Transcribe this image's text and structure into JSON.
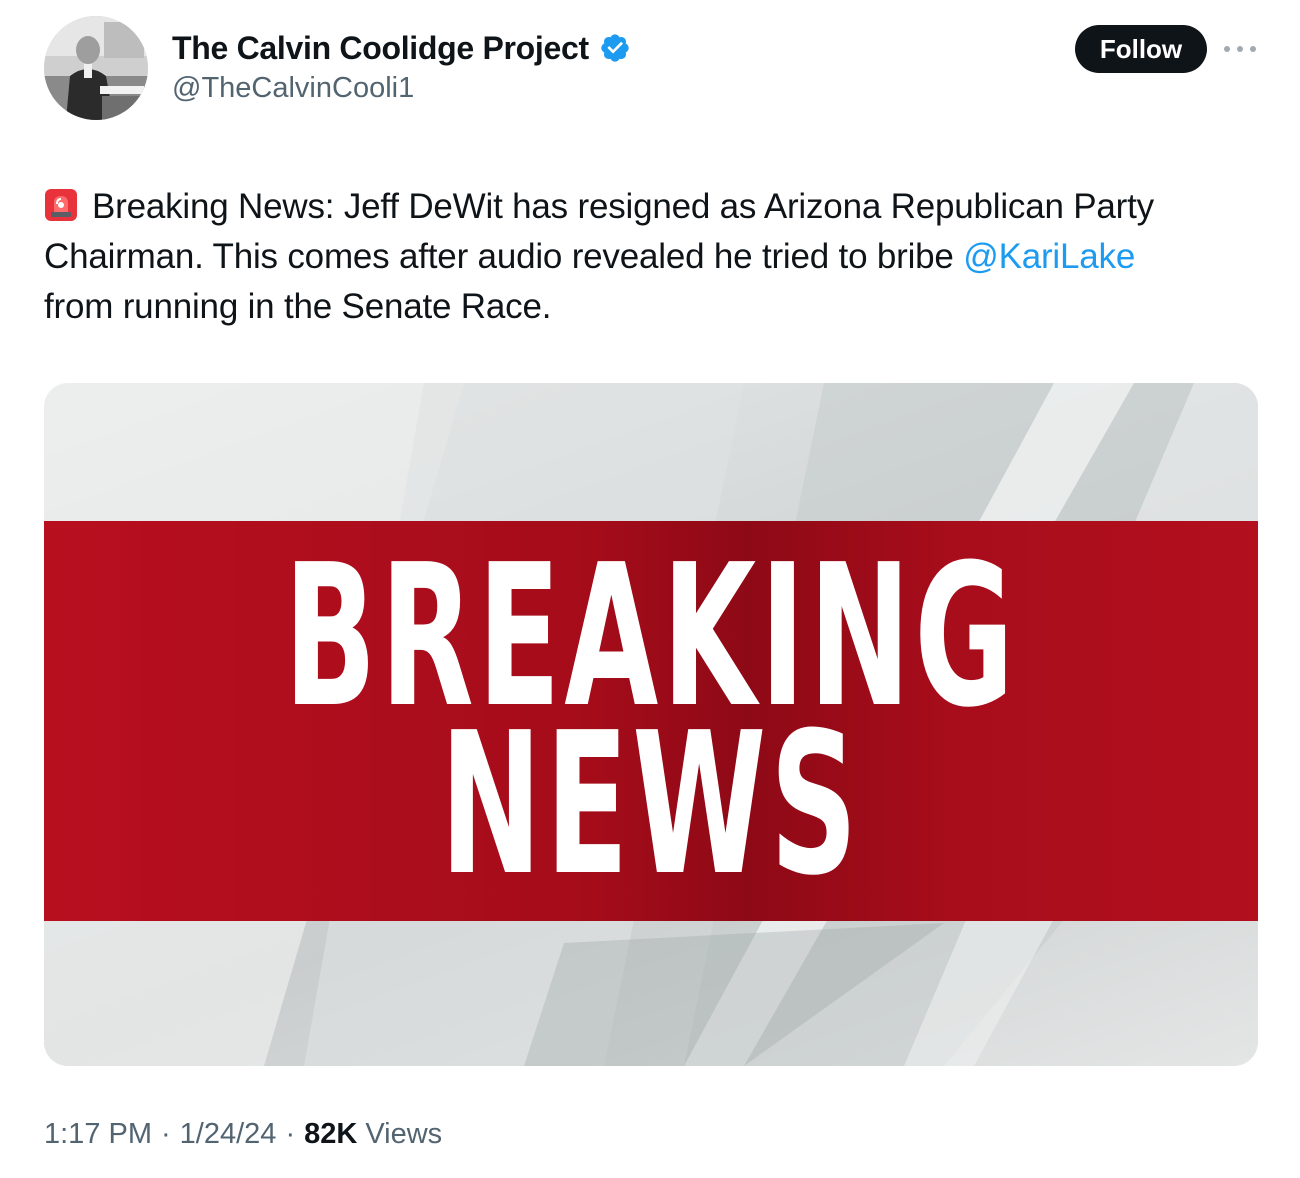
{
  "author": {
    "display_name": "The Calvin Coolidge Project",
    "handle": "@TheCalvinCooli1",
    "verified": true
  },
  "header": {
    "follow_label": "Follow"
  },
  "tweet": {
    "line1_text": "Breaking News: Jeff DeWit has resigned as Arizona Republican Party",
    "line2_text": "Chairman. This comes after audio revealed he tried to bribe ",
    "mention": "@KariLake",
    "line3_text": "from running in the Senate Race."
  },
  "media": {
    "line1": "BREAKING",
    "line2": "NEWS"
  },
  "meta": {
    "time": "1:17 PM",
    "date": "1/24/24",
    "views_count": "82K",
    "views_label": "Views",
    "separator": "·"
  },
  "colors": {
    "text": "#0f1419",
    "secondary": "#536471",
    "link": "#1d9bf0",
    "verified": "#1d9bf0",
    "banner_red": "#a80d1b"
  }
}
